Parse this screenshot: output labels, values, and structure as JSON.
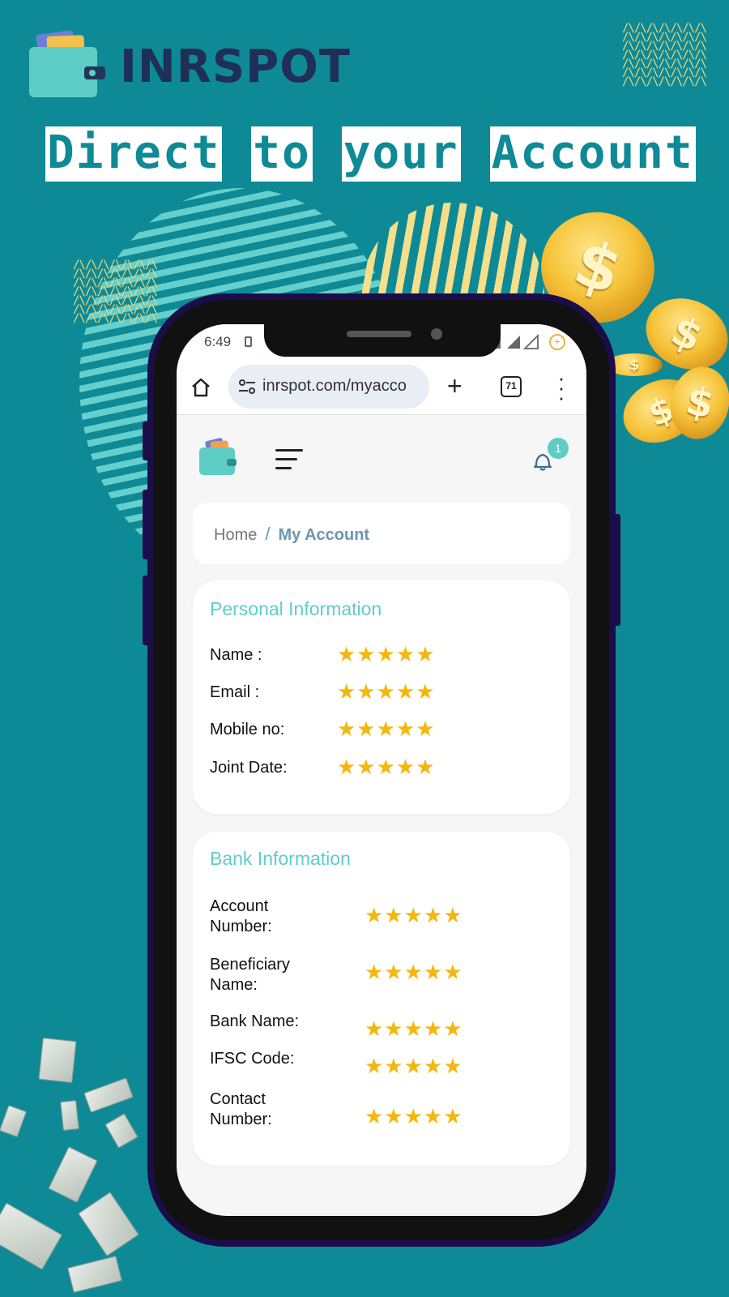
{
  "poster": {
    "brand_name": "INRSPOT",
    "headline_words": [
      "Direct",
      "to",
      "your",
      "Account"
    ],
    "coin_symbol": "$",
    "colors": {
      "background": "#0e8a96",
      "accent": "#5ecdc6",
      "gold": "#f5b70e",
      "phone_frame": "#1b0d49"
    }
  },
  "status_bar": {
    "time": "6:49",
    "battery_indicator": "+"
  },
  "browser": {
    "url": "inrspot.com/myacco",
    "tab_count": "71",
    "icons": [
      "home-icon",
      "site-settings-icon",
      "new-tab-icon",
      "tab-switcher-icon",
      "menu-icon"
    ]
  },
  "app_header": {
    "notification_count": "1",
    "icons": [
      "wallet-logo-icon",
      "hamburger-menu-icon",
      "bell-icon"
    ]
  },
  "breadcrumb": {
    "home": "Home",
    "separator": "/",
    "current": "My Account"
  },
  "personal_information": {
    "title": "Personal Information",
    "rows": [
      {
        "label": "Name :",
        "value": "★★★★★"
      },
      {
        "label": "Email :",
        "value": "★★★★★"
      },
      {
        "label": "Mobile no:",
        "value": "★★★★★"
      },
      {
        "label": "Joint Date:",
        "value": "★★★★★"
      }
    ]
  },
  "bank_information": {
    "title": "Bank Information",
    "rows": [
      {
        "label_line1": "Account",
        "label_line2": "Number:",
        "value": "★★★★★"
      },
      {
        "label_line1": "Beneficiary",
        "label_line2": "Name:",
        "value": "★★★★★"
      },
      {
        "label_line1": "Bank Name:",
        "label_line2": "",
        "value": "★★★★★"
      },
      {
        "label_line1": "IFSC Code:",
        "label_line2": "",
        "value": "★★★★★"
      },
      {
        "label_line1": "Contact",
        "label_line2": "Number:",
        "value": "★★★★★"
      }
    ]
  }
}
